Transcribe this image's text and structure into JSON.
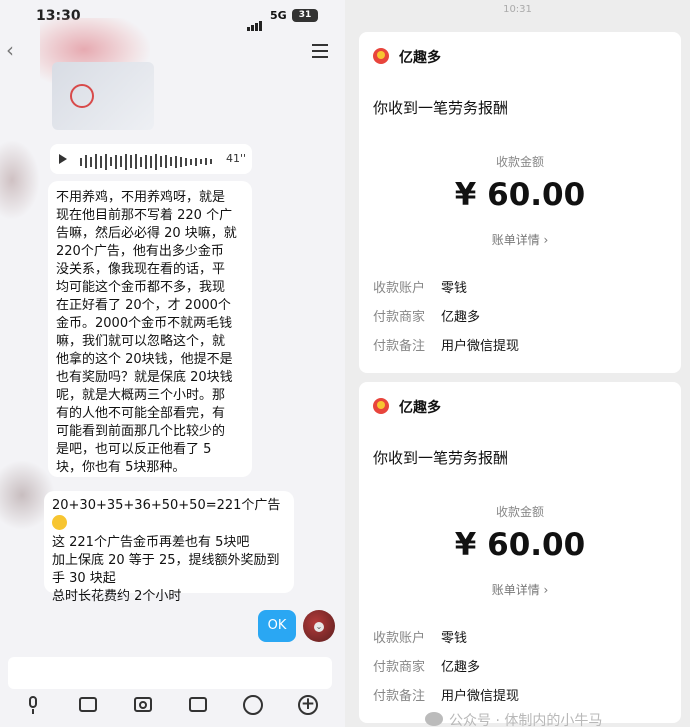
{
  "left": {
    "status": {
      "time": "13:30",
      "network": "5G",
      "battery": "31"
    },
    "voice": {
      "duration": "41''"
    },
    "messages": [
      "不用养鸡，不用养鸡呀，就是\n现在他目前那不写着 220 个广\n告嘛，然后必必得 20 块嘛，就\n220个广告，他有出多少金币\n没关系，像我现在看的话，平\n均可能这个金币都不多，我现\n在正好看了 20个，才 2000个\n金币。2000个金币不就两毛钱\n嘛，我们就可以忽略这个，就\n他拿的这个 20块钱，他提不是\n也有奖励吗？就是保底 20块钱\n呢，就是大概两三个小时。那\n有的人他不可能全部看完，有\n可能看到前面那几个比较少的\n是吧，也可以反正他看了 5\n块，你也有 5块那种。",
      "20+30+35+36+50+50=221个广告",
      "这 221个广告金币再差也有 5块吧\n加上保底 20 等于 25，提线额外奖励到\n手 30 块起\n总时长花费约 2个小时"
    ],
    "sent": {
      "ok": "OK"
    }
  },
  "right": {
    "time": "10:31",
    "cards": [
      {
        "brand": "亿趣多",
        "headline": "你收到一笔劳务报酬",
        "amount_label": "收款金额",
        "amount": "¥ 60.00",
        "detail_link": "账单详情 ›",
        "rows": [
          {
            "key": "收款账户",
            "value": "零钱"
          },
          {
            "key": "付款商家",
            "value": "亿趣多"
          },
          {
            "key": "付款备注",
            "value": "用户微信提现"
          }
        ]
      },
      {
        "brand": "亿趣多",
        "headline": "你收到一笔劳务报酬",
        "amount_label": "收款金额",
        "amount": "¥ 60.00",
        "detail_link": "账单详情 ›",
        "rows": [
          {
            "key": "收款账户",
            "value": "零钱"
          },
          {
            "key": "付款商家",
            "value": "亿趣多"
          },
          {
            "key": "付款备注",
            "value": "用户微信提现"
          }
        ]
      }
    ],
    "watermark": "公众号 · 体制内的小牛马"
  },
  "icons": {
    "back": "back-arrow-icon",
    "menu": "hamburger-menu-icon",
    "toolbar": [
      "microphone-icon",
      "image-icon",
      "camera-icon",
      "sticker-icon",
      "emoji-icon",
      "plus-icon"
    ]
  }
}
